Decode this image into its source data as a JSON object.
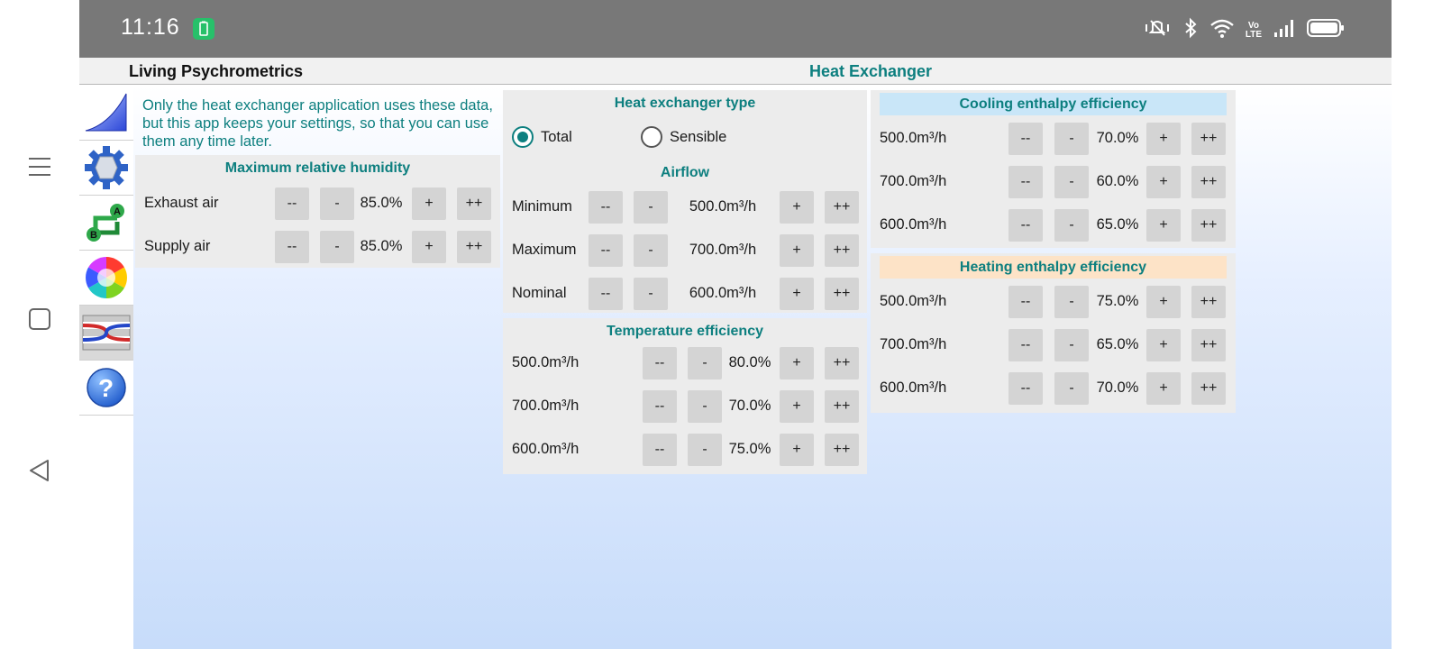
{
  "status": {
    "time": "11:16"
  },
  "app": {
    "title": "Living Psychrometrics",
    "page_title": "Heat Exchanger"
  },
  "sidebar": {
    "items": [
      {
        "name": "chart-icon"
      },
      {
        "name": "settings-gear-icon"
      },
      {
        "name": "process-ab-icon"
      },
      {
        "name": "color-wheel-icon"
      },
      {
        "name": "heat-exchanger-icon",
        "active": true
      },
      {
        "name": "help-icon"
      }
    ]
  },
  "buttons": {
    "dec_big": "--",
    "dec": "-",
    "inc": "+",
    "inc_big": "++"
  },
  "humidity": {
    "intro": "Only the heat exchanger application uses these data, but this app keeps your settings, so that you can use them any time later.",
    "title": "Maximum relative humidity",
    "rows": [
      {
        "label": "Exhaust air",
        "value": "85.0%"
      },
      {
        "label": "Supply air",
        "value": "85.0%"
      }
    ]
  },
  "exchanger_type": {
    "title": "Heat exchanger type",
    "options": [
      {
        "label": "Total",
        "selected": true
      },
      {
        "label": "Sensible",
        "selected": false
      }
    ]
  },
  "airflow": {
    "title": "Airflow",
    "rows": [
      {
        "label": "Minimum",
        "value": "500.0m³/h"
      },
      {
        "label": "Maximum",
        "value": "700.0m³/h"
      },
      {
        "label": "Nominal",
        "value": "600.0m³/h"
      }
    ]
  },
  "temperature_efficiency": {
    "title": "Temperature efficiency",
    "rows": [
      {
        "label": "500.0m³/h",
        "value": "80.0%"
      },
      {
        "label": "700.0m³/h",
        "value": "70.0%"
      },
      {
        "label": "600.0m³/h",
        "value": "75.0%"
      }
    ]
  },
  "cooling_efficiency": {
    "title": "Cooling enthalpy efficiency",
    "header_color": "#c9e6f8",
    "rows": [
      {
        "label": "500.0m³/h",
        "value": "70.0%"
      },
      {
        "label": "700.0m³/h",
        "value": "60.0%"
      },
      {
        "label": "600.0m³/h",
        "value": "65.0%"
      }
    ]
  },
  "heating_efficiency": {
    "title": "Heating enthalpy efficiency",
    "header_color": "#fde3c7",
    "rows": [
      {
        "label": "500.0m³/h",
        "value": "75.0%"
      },
      {
        "label": "700.0m³/h",
        "value": "65.0%"
      },
      {
        "label": "600.0m³/h",
        "value": "70.0%"
      }
    ]
  }
}
